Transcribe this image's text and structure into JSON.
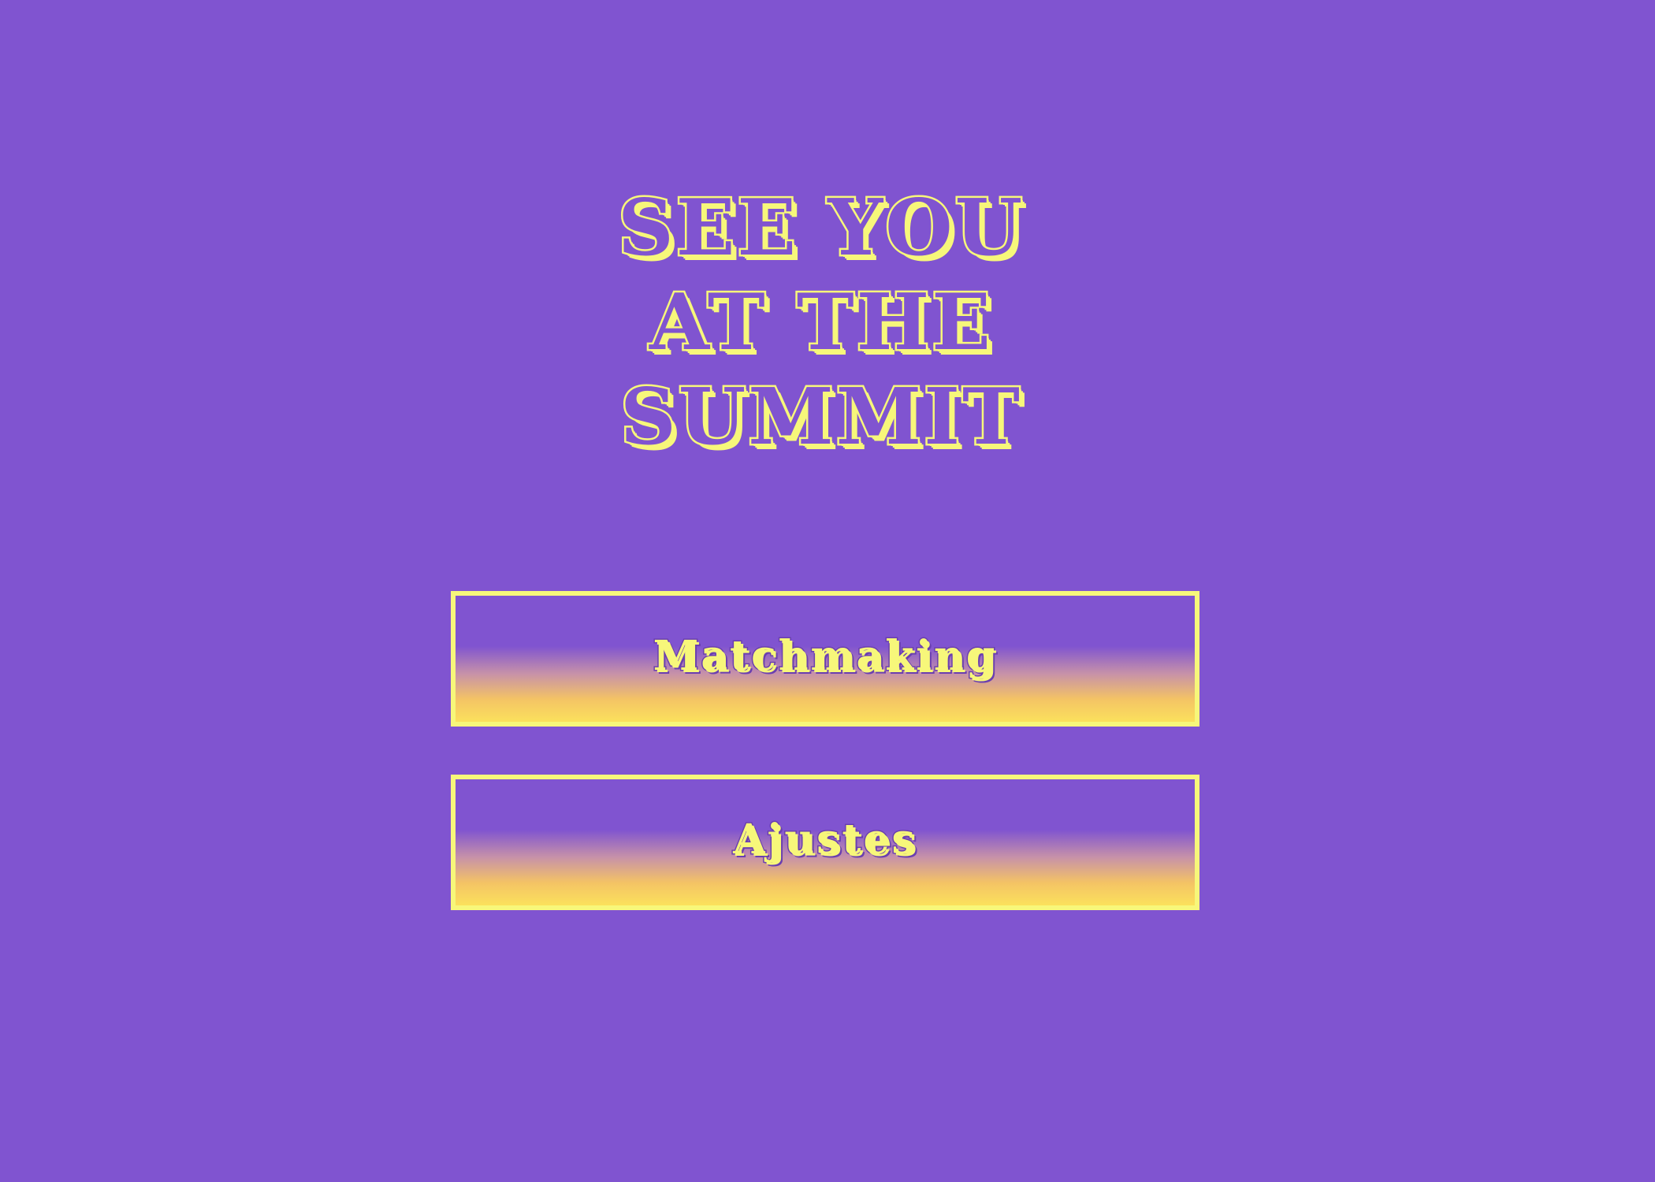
{
  "game": {
    "title_lines": [
      "SEE YOU",
      "AT THE",
      "SUMMIT"
    ]
  },
  "menu": {
    "items": [
      {
        "label": "Matchmaking"
      },
      {
        "label": "Ajustes"
      }
    ]
  },
  "colors": {
    "background": "#8054d0",
    "accent_yellow": "#f7f77a",
    "gradient_bottom": "#fbe15c"
  }
}
